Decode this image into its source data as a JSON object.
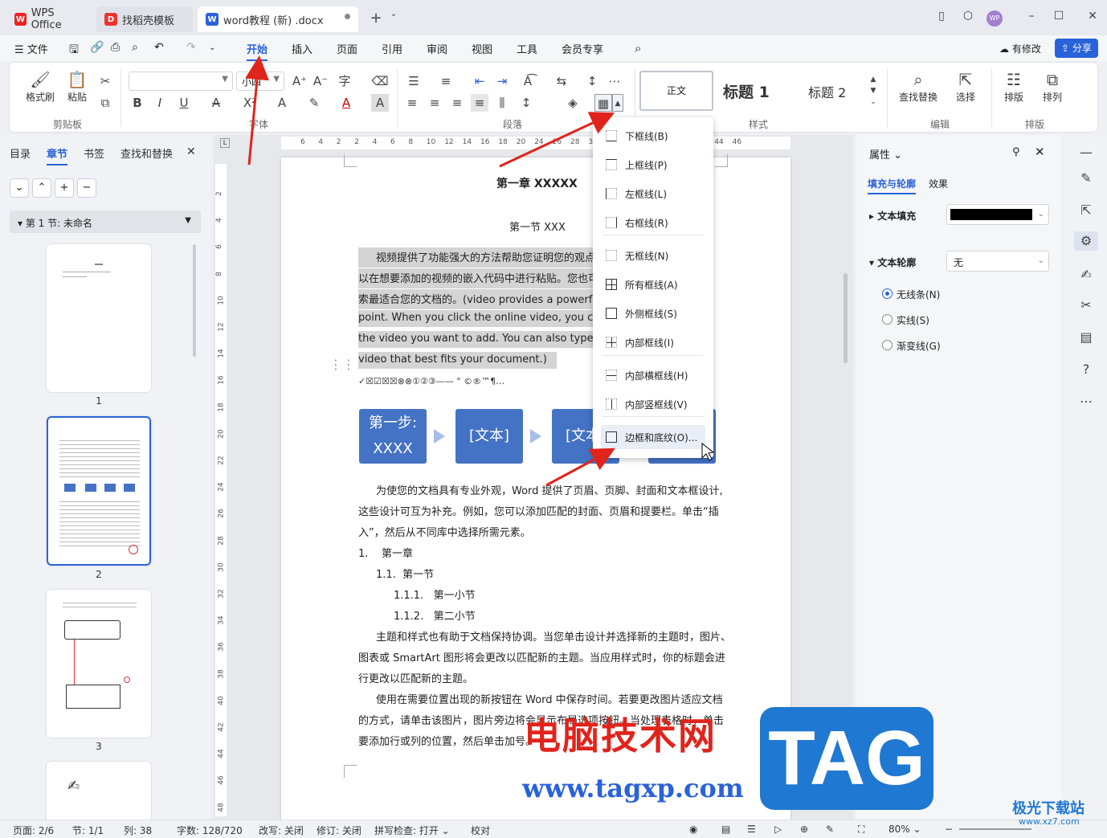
{
  "tabs": [
    {
      "label": "WPS Office",
      "icon": "wps-icon"
    },
    {
      "label": "找稻壳模板",
      "icon": "docer-icon"
    },
    {
      "label": "word教程 (新) .docx",
      "icon": "word-icon"
    }
  ],
  "user_badge": "WP",
  "menu": {
    "file": "文件",
    "items": [
      "开始",
      "插入",
      "页面",
      "引用",
      "审阅",
      "视图",
      "工具",
      "会员专享"
    ],
    "modified": "有修改",
    "share": "分享"
  },
  "ribbon": {
    "format_painter": "格式刷",
    "paste": "粘贴",
    "clipboard_group": "剪贴板",
    "font_group": "字体",
    "font_size": "小四",
    "paragraph_group": "段落",
    "styles": {
      "normal": "正文",
      "h1": "标题  1",
      "h2": "标题  2"
    },
    "style_group": "样式",
    "find_replace": "查找替换",
    "select": "选择",
    "edit_group": "编辑",
    "arrange_text": "排版",
    "arrange": "排列",
    "arrange_group": "排版"
  },
  "nav": {
    "tabs": [
      "目录",
      "章节",
      "书签",
      "查找和替换"
    ],
    "section": "第 1 节: 未命名",
    "pages": [
      "1",
      "2",
      "3"
    ]
  },
  "ruler": {
    "h_ticks": [
      "6",
      "4",
      "2",
      "2",
      "4",
      "6",
      "8",
      "10",
      "12",
      "14",
      "16",
      "18",
      "20",
      "24",
      "26",
      "28",
      "30",
      "32",
      "34",
      "36",
      "38",
      "40",
      "42",
      "44",
      "46"
    ],
    "v_ticks": [
      "2",
      "4",
      "6",
      "8",
      "10",
      "12",
      "14",
      "16",
      "18",
      "20",
      "22",
      "24",
      "26",
      "28",
      "30",
      "32",
      "34",
      "36",
      "38",
      "40",
      "42",
      "44",
      "46",
      "48"
    ]
  },
  "document": {
    "chapter_title": "第一章  XXXXX",
    "section_title": "第一节  XXX",
    "para1": [
      "视频提供了功能强大的方法帮助您证明您的观点",
      "以在想要添加的视频的嵌入代码中进行粘贴。您也可",
      "索最适合您的文档的。(video provides a powerful",
      "point. When you click the online video, you can paste",
      "the video you want to add. You can also type a keyw",
      "video that best fits your document.)"
    ],
    "symbols": "✓☒☑☒☒⊗⊗①②③——    °  ©®™¶…",
    "flow": [
      "第一步:\nXXXX",
      "[文本]",
      "[文本]",
      ""
    ],
    "para2": [
      "为使您的文档具有专业外观，Word  提供了页眉、页脚、封面和文本框设计,",
      "这些设计可互为补充。例如，您可以添加匹配的封面、页眉和提要栏。单击“插",
      "入”，然后从不同库中选择所需元素。"
    ],
    "list": [
      {
        "num": "1.",
        "text": "第一章"
      },
      {
        "num": "1.1.",
        "text": "第一节"
      },
      {
        "num": "1.1.1.",
        "text": "第一小节"
      },
      {
        "num": "1.1.2.",
        "text": "第二小节"
      }
    ],
    "para3": [
      "主题和样式也有助于文档保持协调。当您单击设计并选择新的主题时，图片、",
      "图表或  SmartArt  图形将会更改以匹配新的主题。当应用样式时，你的标题会进",
      "行更改以匹配新的主题。"
    ],
    "para4": [
      "使用在需要位置出现的新按钮在  Word  中保存时间。若要更改图片适应文档",
      "的方式，请单击该图片，图片旁边将会显示布局选项按钮。当处理表格时，单击",
      "要添加行或列的位置，然后单击加号。"
    ]
  },
  "border_menu": [
    {
      "label": "下框线(B)",
      "icon": "bottom-border-icon"
    },
    {
      "label": "上框线(P)",
      "icon": "top-border-icon"
    },
    {
      "label": "左框线(L)",
      "icon": "left-border-icon"
    },
    {
      "label": "右框线(R)",
      "icon": "right-border-icon"
    },
    {
      "label": "无框线(N)",
      "icon": "no-border-icon"
    },
    {
      "label": "所有框线(A)",
      "icon": "all-borders-icon"
    },
    {
      "label": "外侧框线(S)",
      "icon": "outside-borders-icon"
    },
    {
      "label": "内部框线(I)",
      "icon": "inside-borders-icon"
    },
    {
      "label": "内部横框线(H)",
      "icon": "inside-horizontal-border-icon"
    },
    {
      "label": "内部竖框线(V)",
      "icon": "inside-vertical-border-icon"
    },
    {
      "label": "边框和底纹(O)...",
      "icon": "borders-shading-icon"
    }
  ],
  "properties": {
    "title": "属性",
    "tabs": [
      "填充与轮廓",
      "效果"
    ],
    "text_fill": "文本填充",
    "text_fill_color": "#000000",
    "text_outline": "文本轮廓",
    "outline_value": "无",
    "options": [
      "无线条(N)",
      "实线(S)",
      "渐变线(G)"
    ]
  },
  "status": {
    "page": "页面: 2/6",
    "section": "节: 1/1",
    "column": "列: 38",
    "words": "字数: 128/720",
    "overtype": "改写: 关闭",
    "revision": "修订: 关闭",
    "spell": "拼写检查: 打开",
    "proof": "校对",
    "zoom": "80%"
  },
  "watermark": {
    "cn": "电脑技术网",
    "url": "www.tagxp.com",
    "tag": "TAG",
    "site": "极光下载站",
    "site_url": "www.xz7.com"
  },
  "colors": {
    "accent": "#2a62d9",
    "flow_box": "#4472c4",
    "arrow_red": "#e0241c",
    "selection": "#d4d4d4"
  }
}
